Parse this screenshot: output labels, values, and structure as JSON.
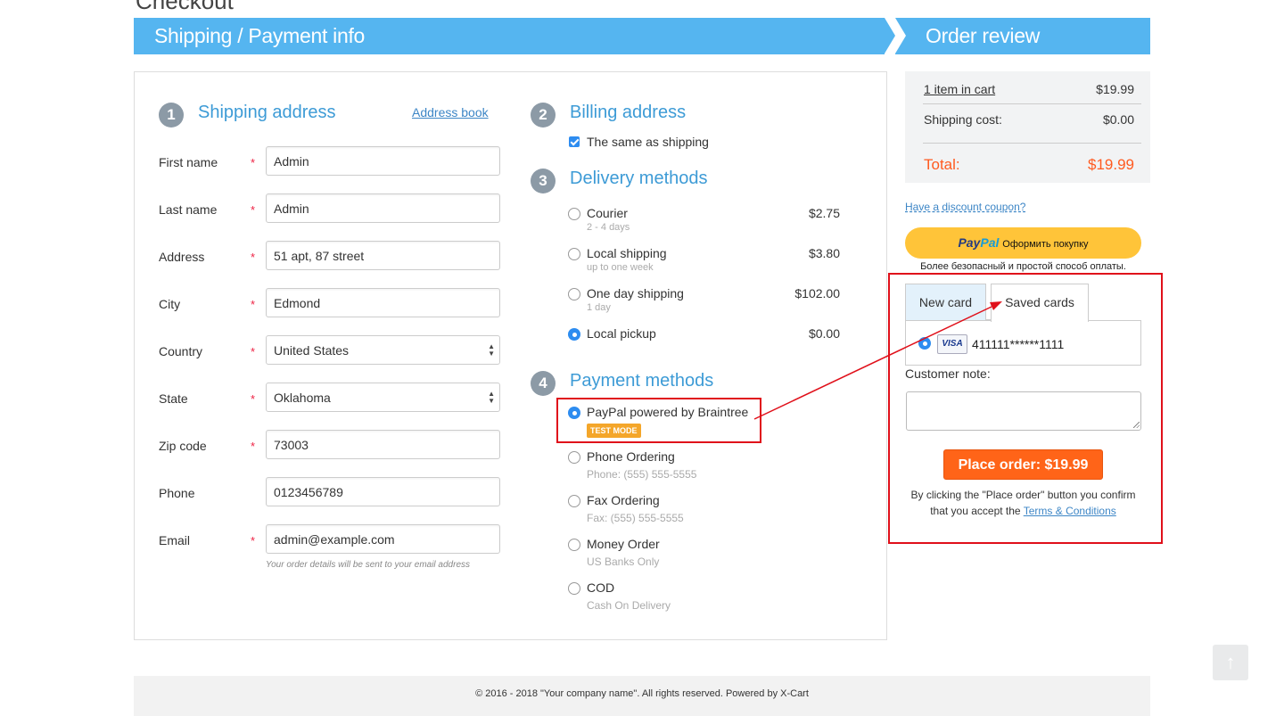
{
  "page": {
    "title_partial": "Checkout"
  },
  "headers": {
    "left": "Shipping / Payment info",
    "right": "Order review"
  },
  "shipping": {
    "step": "1",
    "title": "Shipping address",
    "address_book_link": "Address book",
    "fields": {
      "first_name": {
        "label": "First name",
        "value": "Admin"
      },
      "last_name": {
        "label": "Last name",
        "value": "Admin"
      },
      "address": {
        "label": "Address",
        "value": "51 apt, 87 street"
      },
      "city": {
        "label": "City",
        "value": "Edmond"
      },
      "country": {
        "label": "Country",
        "value": "United States"
      },
      "state": {
        "label": "State",
        "value": "Oklahoma"
      },
      "zip": {
        "label": "Zip code",
        "value": "73003"
      },
      "phone": {
        "label": "Phone",
        "value": "0123456789"
      },
      "email": {
        "label": "Email",
        "value": "admin@example.com"
      }
    },
    "required_marker": "*",
    "email_hint": "Your order details will be sent to your email address"
  },
  "billing": {
    "step": "2",
    "title": "Billing address",
    "same_as_shipping_label": "The same as shipping",
    "same_as_shipping_checked": true
  },
  "delivery": {
    "step": "3",
    "title": "Delivery methods",
    "options": [
      {
        "name": "Courier",
        "sub": "2 - 4 days",
        "price": "$2.75",
        "selected": false
      },
      {
        "name": "Local shipping",
        "sub": "up to one week",
        "price": "$3.80",
        "selected": false
      },
      {
        "name": "One day shipping",
        "sub": "1 day",
        "price": "$102.00",
        "selected": false
      },
      {
        "name": "Local pickup",
        "sub": "",
        "price": "$0.00",
        "selected": true
      }
    ]
  },
  "payment": {
    "step": "4",
    "title": "Payment methods",
    "test_badge": "TEST MODE",
    "options": [
      {
        "name": "PayPal powered by Braintree",
        "sub": "",
        "selected": true
      },
      {
        "name": "Phone Ordering",
        "sub": "Phone: (555) 555-5555",
        "selected": false
      },
      {
        "name": "Fax Ordering",
        "sub": "Fax: (555) 555-5555",
        "selected": false
      },
      {
        "name": "Money Order",
        "sub": "US Banks Only",
        "selected": false
      },
      {
        "name": "COD",
        "sub": "Cash On Delivery",
        "selected": false
      }
    ]
  },
  "review": {
    "items_link": "1 item in cart",
    "items_price": "$19.99",
    "shipping_label": "Shipping cost:",
    "shipping_price": "$0.00",
    "total_label": "Total:",
    "total_price": "$19.99",
    "coupon_link": "Have a discount coupon?",
    "paypal": {
      "logo_a": "Pay",
      "logo_b": "Pal",
      "button_text": "Оформить покупку",
      "note": "Более безопасный и простой способ оплаты."
    },
    "tabs": [
      "New card",
      "Saved cards"
    ],
    "active_tab": "Saved cards",
    "saved_card": {
      "brand": "VISA",
      "number": "411111******1111",
      "selected": true
    },
    "customer_note_label": "Customer note:",
    "customer_note_value": "",
    "place_order": "Place order: $19.99",
    "terms_text": "By clicking the \"Place order\" button you confirm that you accept the",
    "terms_link": "Terms & Conditions"
  },
  "footer": {
    "text": "© 2016 - 2018 \"Your company name\". All rights reserved. Powered by X-Cart"
  },
  "back_to_top": "↑",
  "colors": {
    "header_blue": "#55b5f0",
    "accent_orange": "#ff6418",
    "total_orange": "#ff5a1f",
    "annotation_red": "#e0101a",
    "paypal_yellow": "#ffc439"
  }
}
